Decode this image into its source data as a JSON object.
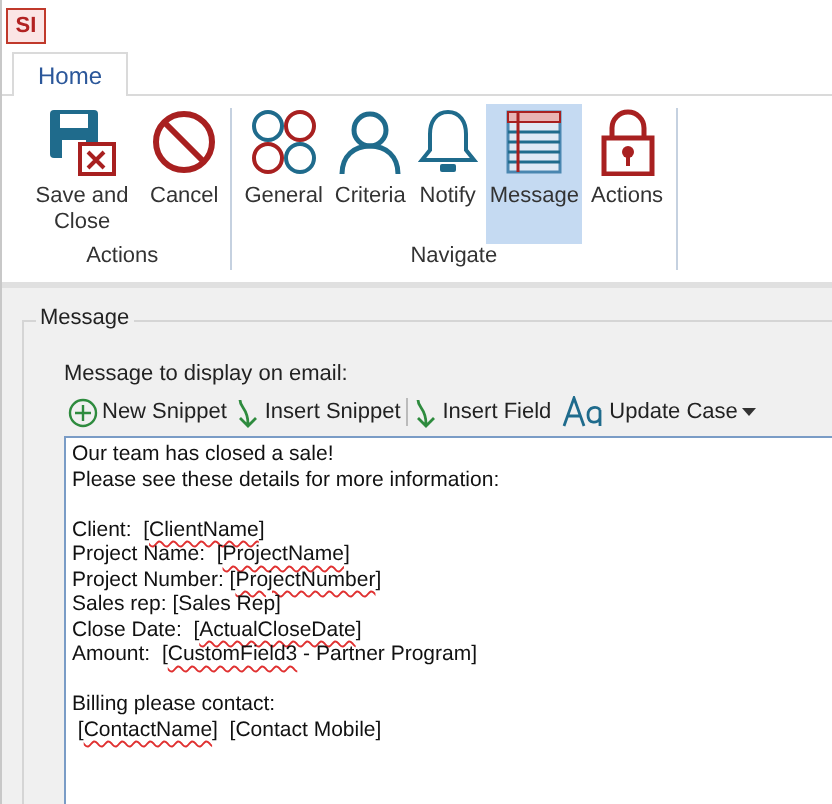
{
  "app": {
    "logo": "SI"
  },
  "tabs": [
    {
      "label": "Home",
      "selected": true
    }
  ],
  "ribbon": {
    "groups": [
      {
        "label": "Actions",
        "buttons": [
          {
            "label": "Save and Close",
            "selected": false
          },
          {
            "label": "Cancel",
            "selected": false
          }
        ]
      },
      {
        "label": "Navigate",
        "buttons": [
          {
            "label": "General",
            "selected": false
          },
          {
            "label": "Criteria",
            "selected": false
          },
          {
            "label": "Notify",
            "selected": false
          },
          {
            "label": "Message",
            "selected": true
          },
          {
            "label": "Actions",
            "selected": false
          }
        ]
      }
    ]
  },
  "message_group": {
    "title": "Message",
    "prompt": "Message to display on email:",
    "toolbar": [
      {
        "kind": "button",
        "label": "New Snippet"
      },
      {
        "kind": "button",
        "label": "Insert Snippet"
      },
      {
        "kind": "separator"
      },
      {
        "kind": "button",
        "label": "Insert Field"
      },
      {
        "kind": "dropdown",
        "label": "Update Case"
      }
    ],
    "paragraphs": [
      [
        [
          {
            "text": "Our team has closed a sale!"
          }
        ],
        [
          {
            "text": "Please see these details for more information:"
          }
        ]
      ],
      [
        [
          {
            "text": "Client:  ["
          },
          {
            "text": "ClientName",
            "misspelled": true
          },
          {
            "text": "]"
          }
        ],
        [
          {
            "text": "Project Name:  ["
          },
          {
            "text": "ProjectName",
            "misspelled": true
          },
          {
            "text": "]"
          }
        ],
        [
          {
            "text": "Project Number: ["
          },
          {
            "text": "ProjectNumber",
            "misspelled": true
          },
          {
            "text": "]"
          }
        ],
        [
          {
            "text": "Sales rep: [Sales Rep]"
          }
        ],
        [
          {
            "text": "Close Date:  ["
          },
          {
            "text": "ActualCloseDate",
            "misspelled": true
          },
          {
            "text": "]"
          }
        ],
        [
          {
            "text": "Amount:  ["
          },
          {
            "text": "CustomField3",
            "misspelled": true
          },
          {
            "text": " - Partner Program]"
          }
        ]
      ],
      [
        [
          {
            "text": "Billing please contact:"
          }
        ],
        [
          {
            "text": " ["
          },
          {
            "text": "ContactName",
            "misspelled": true
          },
          {
            "text": "]  [Contact Mobile]"
          }
        ]
      ]
    ]
  }
}
